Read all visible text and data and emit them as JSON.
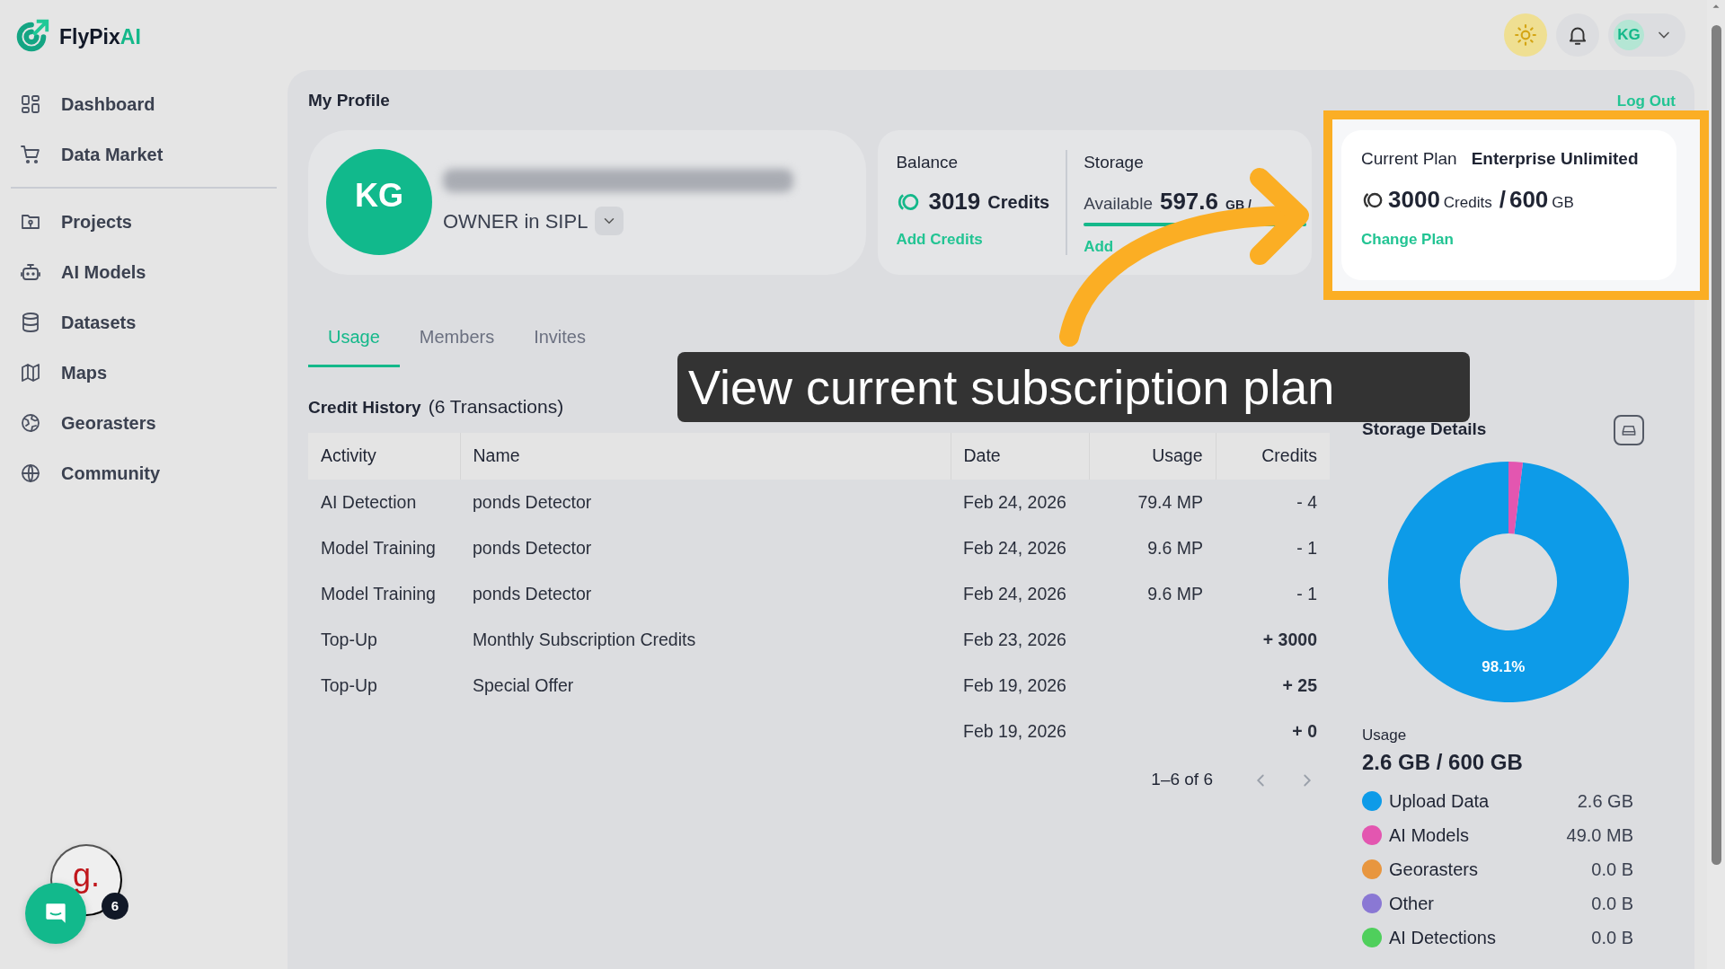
{
  "brand": {
    "name": "FlyPix",
    "suffix": "AI"
  },
  "sidebar": {
    "groups": [
      [
        {
          "label": "Dashboard"
        },
        {
          "label": "Data Market"
        }
      ],
      [
        {
          "label": "Projects"
        },
        {
          "label": "AI Models"
        },
        {
          "label": "Datasets"
        },
        {
          "label": "Maps"
        },
        {
          "label": "Georasters"
        },
        {
          "label": "Community"
        }
      ]
    ]
  },
  "header": {
    "avatar": "KG"
  },
  "profile": {
    "title": "My Profile",
    "logout": "Log Out",
    "avatar": "KG",
    "role": "OWNER in SIPL"
  },
  "balance": {
    "label": "Balance",
    "amount": "3019",
    "unit": "Credits",
    "action": "Add Credits"
  },
  "storage": {
    "label": "Storage",
    "prefix": "Available",
    "amount": "597.6",
    "unit": "GB /",
    "level": 1,
    "action": "Add"
  },
  "plan": {
    "label": "Current Plan",
    "name": "Enterprise Unlimited",
    "credits": "3000",
    "credits_unit": "Credits",
    "separator": "/",
    "storage": "600",
    "storage_unit": "GB",
    "action": "Change Plan"
  },
  "tabs": [
    {
      "label": "Usage",
      "selected": true
    },
    {
      "label": "Members",
      "selected": false
    },
    {
      "label": "Invites",
      "selected": false
    }
  ],
  "history": {
    "title": "Credit History",
    "count": "(6 Transactions)",
    "columns": [
      "Activity",
      "Name",
      "Date",
      "Usage",
      "Credits"
    ],
    "rows": [
      {
        "activity": "AI Detection",
        "name": "ponds Detector",
        "date": "Feb 24, 2026",
        "usage": "79.4 MP",
        "credits": "- 4",
        "kind": "debit"
      },
      {
        "activity": "Model Training",
        "name": "ponds Detector",
        "date": "Feb 24, 2026",
        "usage": "9.6 MP",
        "credits": "- 1",
        "kind": "debit"
      },
      {
        "activity": "Model Training",
        "name": "ponds Detector",
        "date": "Feb 24, 2026",
        "usage": "9.6 MP",
        "credits": "- 1",
        "kind": "debit"
      },
      {
        "activity": "Top-Up",
        "name": "Monthly Subscription Credits",
        "date": "Feb 23, 2026",
        "credits": "+ 3000",
        "kind": "credit"
      },
      {
        "activity": "Top-Up",
        "name": "Special Offer",
        "date": "Feb 19, 2026",
        "credits": "+ 25",
        "kind": "credit"
      },
      {
        "date": "Feb 19, 2026",
        "credits": "+ 0",
        "kind": "credit"
      }
    ],
    "pagination": "1–6 of 6"
  },
  "storage_details": {
    "title": "Storage Details",
    "chart_data": {
      "type": "donut",
      "values": [
        98.1,
        1.9
      ],
      "value_labels": [
        "98.1%",
        null
      ]
    },
    "usage_label": "Usage",
    "usage_value": "2.6 GB / 600 GB",
    "legend": [
      {
        "label": "Upload Data",
        "value": "2.6 GB",
        "color": "#0d9be8"
      },
      {
        "label": "AI Models",
        "value": "49.0 MB",
        "color": "#e356b0"
      },
      {
        "label": "Georasters",
        "value": "0.0 B",
        "color": "#e8963f"
      },
      {
        "label": "Other",
        "value": "0.0 B",
        "color": "#8a78d4"
      },
      {
        "label": "AI Detections",
        "value": "0.0 B",
        "color": "#4fcf5c"
      }
    ]
  },
  "caption": "View current subscription plan",
  "widgets": {
    "logo": "g.",
    "badge": "6"
  }
}
